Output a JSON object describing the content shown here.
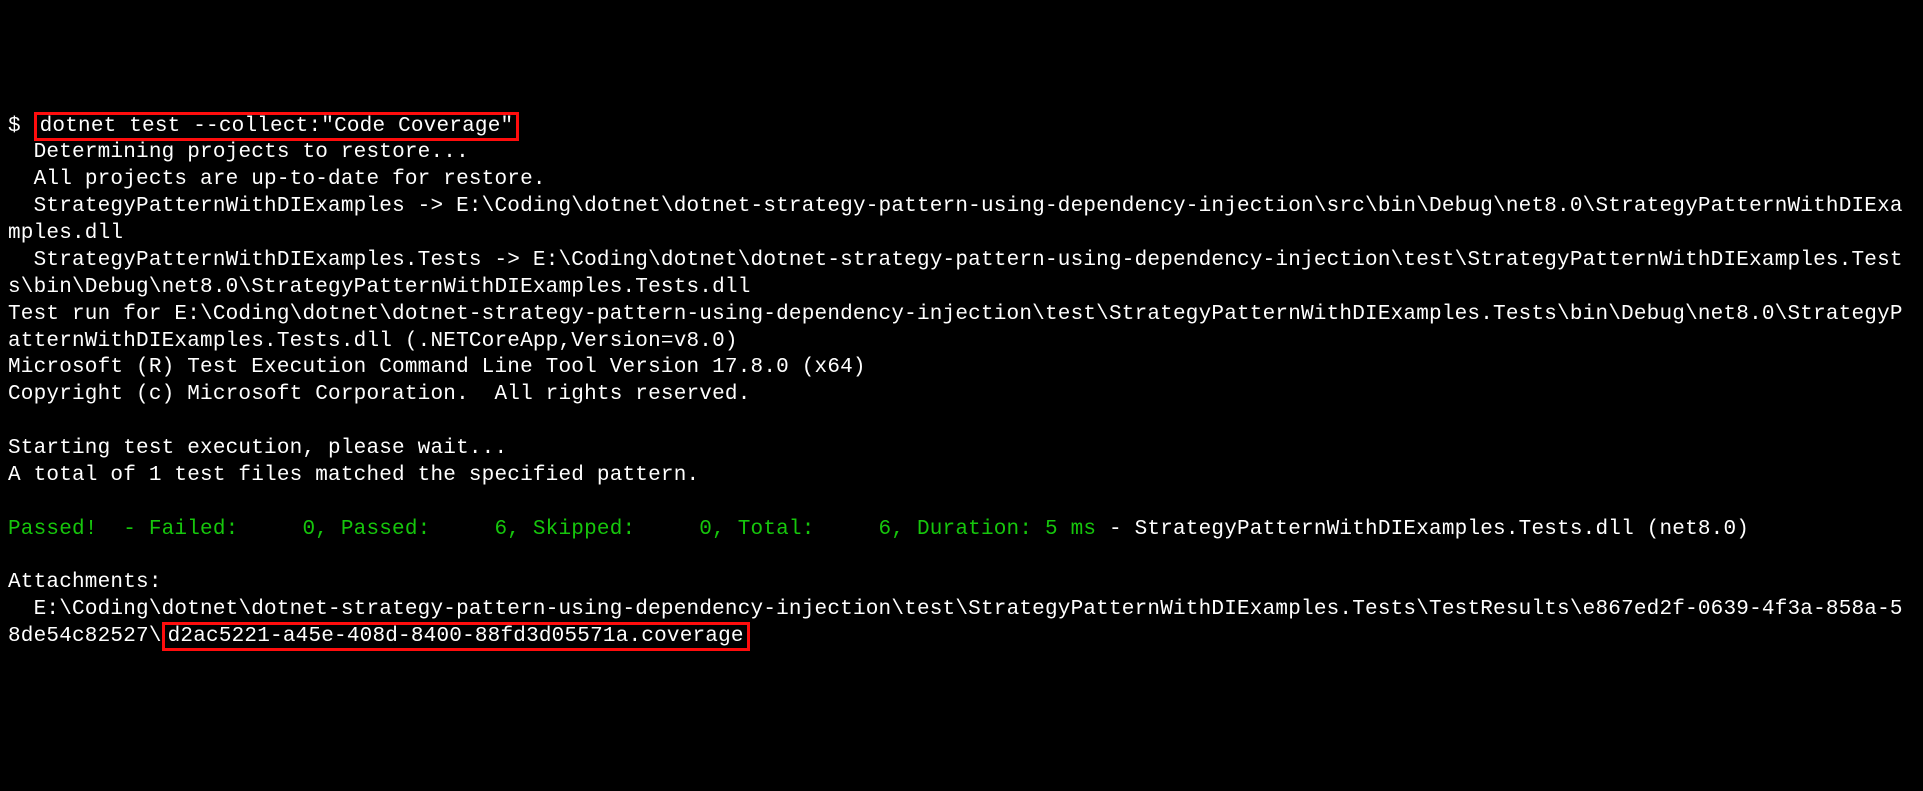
{
  "prompt_symbol": "$",
  "command": "dotnet test --collect:\"Code Coverage\"",
  "out": {
    "l1": "  Determining projects to restore...",
    "l2": "  All projects are up-to-date for restore.",
    "l3": "  StrategyPatternWithDIExamples -> E:\\Coding\\dotnet\\dotnet-strategy-pattern-using-dependency-injection\\src\\bin\\Debug\\net8.0\\StrategyPatternWithDIExamples.dll",
    "l4": "  StrategyPatternWithDIExamples.Tests -> E:\\Coding\\dotnet\\dotnet-strategy-pattern-using-dependency-injection\\test\\StrategyPatternWithDIExamples.Tests\\bin\\Debug\\net8.0\\StrategyPatternWithDIExamples.Tests.dll",
    "l5": "Test run for E:\\Coding\\dotnet\\dotnet-strategy-pattern-using-dependency-injection\\test\\StrategyPatternWithDIExamples.Tests\\bin\\Debug\\net8.0\\StrategyPatternWithDIExamples.Tests.dll (.NETCoreApp,Version=v8.0)",
    "l6": "Microsoft (R) Test Execution Command Line Tool Version 17.8.0 (x64)",
    "l7": "Copyright (c) Microsoft Corporation.  All rights reserved.",
    "blank1": " ",
    "l8": "Starting test execution, please wait...",
    "l9": "A total of 1 test files matched the specified pattern.",
    "blank2": " ",
    "result_green": "Passed!  - Failed:     0, Passed:     6, Skipped:     0, Total:     6, Duration: 5 ms",
    "result_white": " - StrategyPatternWithDIExamples.Tests.dll (net8.0)",
    "blank3": " ",
    "l10": "Attachments:",
    "attach_prefix": "  E:\\Coding\\dotnet\\dotnet-strategy-pattern-using-dependency-injection\\test\\StrategyPatternWithDIExamples.Tests\\TestResults\\e867ed2f-0639-4f3a-858a-58de54c82527\\",
    "attach_file": "d2ac5221-a45e-408d-8400-88fd3d05571a.coverage"
  }
}
